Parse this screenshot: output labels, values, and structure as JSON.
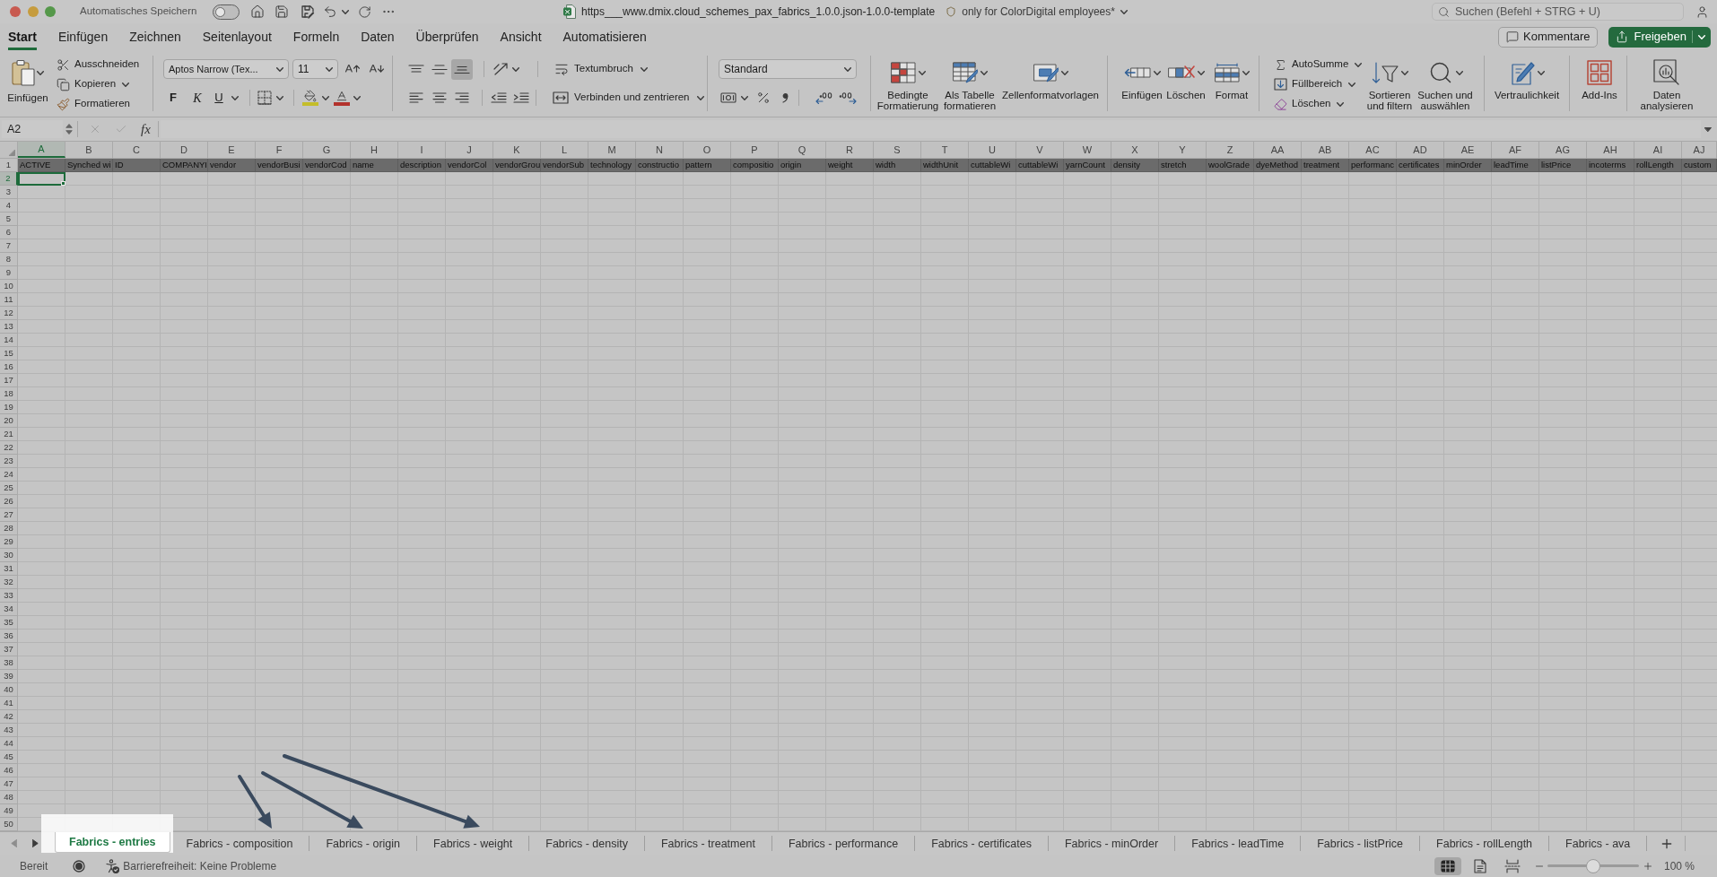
{
  "title_bar": {
    "autosave": {
      "label": "Automatisches Speichern",
      "on": false
    },
    "document_title": "https___www.dmix.cloud_schemes_pax_fabrics_1.0.0.json-1.0.0-template",
    "sensitivity_label": "only for ColorDigital employees*",
    "search": {
      "placeholder": "Suchen (Befehl + STRG + U)"
    }
  },
  "ribbon_tabs": [
    {
      "label": "Start",
      "selected": true
    },
    {
      "label": "Einfügen",
      "selected": false
    },
    {
      "label": "Zeichnen",
      "selected": false
    },
    {
      "label": "Seitenlayout",
      "selected": false
    },
    {
      "label": "Formeln",
      "selected": false
    },
    {
      "label": "Daten",
      "selected": false
    },
    {
      "label": "Überprüfen",
      "selected": false
    },
    {
      "label": "Ansicht",
      "selected": false
    },
    {
      "label": "Automatisieren",
      "selected": false
    }
  ],
  "header_buttons": {
    "comments": "Kommentare",
    "share": "Freigeben"
  },
  "ribbon": {
    "clipboard": {
      "paste": "Einfügen",
      "cut": "Ausschneiden",
      "copy": "Kopieren",
      "format_painter": "Formatieren"
    },
    "font": {
      "font_name": "Aptos Narrow (Tex...",
      "font_size": "11",
      "bold": "F",
      "italic": "K",
      "underline": "U"
    },
    "alignment": {
      "vertical": [
        {
          "kind": "top",
          "selected": false
        },
        {
          "kind": "middle",
          "selected": false
        },
        {
          "kind": "bottom",
          "selected": true
        }
      ],
      "wrap_text": "Textumbruch",
      "merge_center": "Verbinden und zentrieren"
    },
    "number": {
      "format": "Standard"
    },
    "styles": {
      "conditional_formatting": "Bedingte\nFormatierung",
      "format_as_table": "Als Tabelle\nformatieren",
      "cell_styles": "Zellenformatvorlagen"
    },
    "cells": {
      "insert": "Einfügen",
      "delete": "Löschen",
      "format": "Format"
    },
    "editing": {
      "autosum": "AutoSumme",
      "fill": "Füllbereich",
      "clear": "Löschen",
      "sort_filter": "Sortieren\nund filtern",
      "find_select": "Suchen und\nauswählen"
    },
    "sensitivity": "Vertraulichkeit",
    "add_ins": "Add-Ins",
    "analyze_data": "Daten\nanalysieren"
  },
  "formula_bar": {
    "name_box": "A2",
    "function_button": "fx"
  },
  "sheet": {
    "columns": [
      {
        "letter": "A",
        "header": "ACTIVE",
        "selected": true
      },
      {
        "letter": "B",
        "header": "Synched wi",
        "selected": false
      },
      {
        "letter": "C",
        "header": "ID",
        "selected": false
      },
      {
        "letter": "D",
        "header": "COMPANYI",
        "selected": false
      },
      {
        "letter": "E",
        "header": "vendor",
        "selected": false
      },
      {
        "letter": "F",
        "header": "vendorBusi",
        "selected": false
      },
      {
        "letter": "G",
        "header": "vendorCod",
        "selected": false
      },
      {
        "letter": "H",
        "header": "name",
        "selected": false
      },
      {
        "letter": "I",
        "header": "description",
        "selected": false
      },
      {
        "letter": "J",
        "header": "vendorCol",
        "selected": false
      },
      {
        "letter": "K",
        "header": "vendorGrou",
        "selected": false
      },
      {
        "letter": "L",
        "header": "vendorSub",
        "selected": false
      },
      {
        "letter": "M",
        "header": "technology",
        "selected": false
      },
      {
        "letter": "N",
        "header": "constructio",
        "selected": false
      },
      {
        "letter": "O",
        "header": "pattern",
        "selected": false
      },
      {
        "letter": "P",
        "header": "compositio",
        "selected": false
      },
      {
        "letter": "Q",
        "header": "origin",
        "selected": false
      },
      {
        "letter": "R",
        "header": "weight",
        "selected": false
      },
      {
        "letter": "S",
        "header": "width",
        "selected": false
      },
      {
        "letter": "T",
        "header": "widthUnit",
        "selected": false
      },
      {
        "letter": "U",
        "header": "cuttableWi",
        "selected": false
      },
      {
        "letter": "V",
        "header": "cuttableWi",
        "selected": false
      },
      {
        "letter": "W",
        "header": "yarnCount",
        "selected": false
      },
      {
        "letter": "X",
        "header": "density",
        "selected": false
      },
      {
        "letter": "Y",
        "header": "stretch",
        "selected": false
      },
      {
        "letter": "Z",
        "header": "woolGrade",
        "selected": false
      },
      {
        "letter": "AA",
        "header": "dyeMethod",
        "selected": false
      },
      {
        "letter": "AB",
        "header": "treatment",
        "selected": false
      },
      {
        "letter": "AC",
        "header": "performanc",
        "selected": false
      },
      {
        "letter": "AD",
        "header": "certificates",
        "selected": false
      },
      {
        "letter": "AE",
        "header": "minOrder",
        "selected": false
      },
      {
        "letter": "AF",
        "header": "leadTime",
        "selected": false
      },
      {
        "letter": "AG",
        "header": "listPrice",
        "selected": false
      },
      {
        "letter": "AH",
        "header": "incoterms",
        "selected": false
      },
      {
        "letter": "AI",
        "header": "rollLength",
        "selected": false
      },
      {
        "letter": "AJ",
        "header": "custom",
        "selected": false
      }
    ],
    "rows": [
      {
        "number": "1",
        "selected": false
      },
      {
        "number": "2",
        "selected": true
      },
      {
        "number": "3",
        "selected": false
      },
      {
        "number": "4",
        "selected": false
      },
      {
        "number": "5",
        "selected": false
      },
      {
        "number": "6",
        "selected": false
      },
      {
        "number": "7",
        "selected": false
      },
      {
        "number": "8",
        "selected": false
      },
      {
        "number": "9",
        "selected": false
      },
      {
        "number": "10",
        "selected": false
      },
      {
        "number": "11",
        "selected": false
      },
      {
        "number": "12",
        "selected": false
      },
      {
        "number": "13",
        "selected": false
      },
      {
        "number": "14",
        "selected": false
      },
      {
        "number": "15",
        "selected": false
      },
      {
        "number": "16",
        "selected": false
      },
      {
        "number": "17",
        "selected": false
      },
      {
        "number": "18",
        "selected": false
      },
      {
        "number": "19",
        "selected": false
      },
      {
        "number": "20",
        "selected": false
      },
      {
        "number": "21",
        "selected": false
      },
      {
        "number": "22",
        "selected": false
      },
      {
        "number": "23",
        "selected": false
      },
      {
        "number": "24",
        "selected": false
      },
      {
        "number": "25",
        "selected": false
      },
      {
        "number": "26",
        "selected": false
      },
      {
        "number": "27",
        "selected": false
      },
      {
        "number": "28",
        "selected": false
      },
      {
        "number": "29",
        "selected": false
      },
      {
        "number": "30",
        "selected": false
      },
      {
        "number": "31",
        "selected": false
      },
      {
        "number": "32",
        "selected": false
      },
      {
        "number": "33",
        "selected": false
      },
      {
        "number": "34",
        "selected": false
      },
      {
        "number": "35",
        "selected": false
      },
      {
        "number": "36",
        "selected": false
      },
      {
        "number": "37",
        "selected": false
      },
      {
        "number": "38",
        "selected": false
      },
      {
        "number": "39",
        "selected": false
      },
      {
        "number": "40",
        "selected": false
      },
      {
        "number": "41",
        "selected": false
      },
      {
        "number": "42",
        "selected": false
      },
      {
        "number": "43",
        "selected": false
      },
      {
        "number": "44",
        "selected": false
      },
      {
        "number": "45",
        "selected": false
      },
      {
        "number": "46",
        "selected": false
      },
      {
        "number": "47",
        "selected": false
      },
      {
        "number": "48",
        "selected": false
      },
      {
        "number": "49",
        "selected": false
      },
      {
        "number": "50",
        "selected": false
      }
    ]
  },
  "sheet_tabs": [
    {
      "label": "Fabrics - entries",
      "selected": true
    },
    {
      "label": "Fabrics - composition",
      "selected": false
    },
    {
      "label": "Fabrics - origin",
      "selected": false
    },
    {
      "label": "Fabrics - weight",
      "selected": false
    },
    {
      "label": "Fabrics - density",
      "selected": false
    },
    {
      "label": "Fabrics - treatment",
      "selected": false
    },
    {
      "label": "Fabrics - performance",
      "selected": false
    },
    {
      "label": "Fabrics - certificates",
      "selected": false
    },
    {
      "label": "Fabrics - minOrder",
      "selected": false
    },
    {
      "label": "Fabrics - leadTime",
      "selected": false
    },
    {
      "label": "Fabrics - listPrice",
      "selected": false
    },
    {
      "label": "Fabrics - rollLength",
      "selected": false
    },
    {
      "label": "Fabrics - ava",
      "selected": false
    }
  ],
  "status_bar": {
    "status": "Bereit",
    "accessibility": "Barrierefreiheit: Keine Probleme",
    "views": [
      {
        "kind": "normal",
        "selected": true
      },
      {
        "kind": "page_layout",
        "selected": false
      },
      {
        "kind": "page_break",
        "selected": false
      }
    ],
    "zoom": {
      "level": 0.5,
      "reading": "100 %"
    }
  }
}
